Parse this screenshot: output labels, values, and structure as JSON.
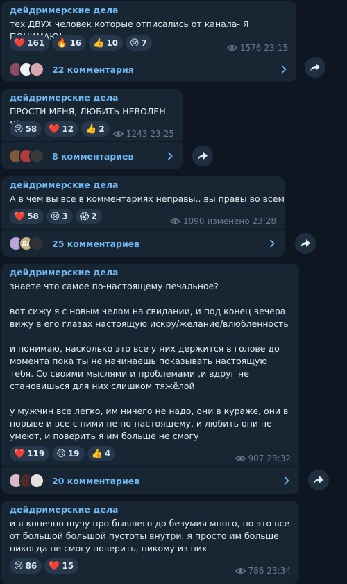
{
  "posts": [
    {
      "channel": "дейдримерские дела",
      "paragraphs": [
        "тех ДВУХ человек которые отписались от канала- Я ПОНИМАЮ!"
      ],
      "reactions": [
        {
          "emoji": "❤️",
          "count": "161"
        },
        {
          "emoji": "🔥",
          "count": "16"
        },
        {
          "emoji": "👍",
          "count": "10"
        },
        {
          "emoji": "😢",
          "count": "7"
        }
      ],
      "views": "1576",
      "time": "23:15",
      "comments": "22 комментария",
      "avatar_colors": [
        "#8a4b63",
        "#f2f2f2",
        "#d8a8b0"
      ]
    },
    {
      "channel": "дейдримерские дела",
      "paragraphs": [
        "ПРОСТИ МЕНЯ, ЛЮБИТЬ НЕВОЛЕН Я("
      ],
      "reactions": [
        {
          "emoji": "😢",
          "count": "58"
        },
        {
          "emoji": "❤️",
          "count": "12"
        },
        {
          "emoji": "👍",
          "count": "2"
        }
      ],
      "views": "1243",
      "time": "23:25",
      "comments": "8 комментариев",
      "avatar_colors": [
        "#7a5a3a",
        "#b03b3b",
        "#3a3a3a"
      ]
    },
    {
      "channel": "дейдримерские дела",
      "paragraphs": [
        "А в чем вы все в комментариях неправы.. вы правы во всем..."
      ],
      "reactions": [
        {
          "emoji": "❤️",
          "count": "58"
        },
        {
          "emoji": "😢",
          "count": "3"
        },
        {
          "emoji": "😱",
          "count": "2"
        }
      ],
      "views": "1090",
      "time": "изменено 23:28",
      "comments": "25 комментариев",
      "avatar_colors": [
        "#b7a7d8",
        "#c7b07a",
        "#2f3338"
      ],
      "avatar_text": [
        "",
        "ДА",
        ""
      ]
    },
    {
      "channel": "дейдримерские дела",
      "paragraphs": [
        "знаете что самое по-настоящему печальное?",
        "вот сижу я с новым челом на свидании, и под конец вечера вижу в его глазах настоящую искру/желание/влюбленность",
        "и понимаю, насколько это все у них держится в голове до момента пока ты не начинаешь показывать настоящую тебя. Со своими мыслями и проблемами ,и вдруг не становишься для них слишком тяжёлой",
        "у мужчин все легко, им ничего не надо, они в кураже, они в порыве и все с ними не по-настоящему, и любить они не умеют, и поверить я им больше не смогу"
      ],
      "reactions": [
        {
          "emoji": "❤️",
          "count": "119"
        },
        {
          "emoji": "😢",
          "count": "19"
        },
        {
          "emoji": "👍",
          "count": "4"
        }
      ],
      "views": "907",
      "time": "23:32",
      "comments": "20 комментариев",
      "avatar_colors": [
        "#d9b8c8",
        "#4a2b2b",
        "#e8e0dc"
      ]
    },
    {
      "channel": "дейдримерские дела",
      "paragraphs": [
        "и я конечно шучу про бывшего до безумия много, но это все от большой большой пустоты внутри. я просто им больше никогда не смогу поверить, никому из них"
      ],
      "reactions": [
        {
          "emoji": "😢",
          "count": "86"
        },
        {
          "emoji": "❤️",
          "count": "15"
        }
      ],
      "views": "786",
      "time": "23:34"
    }
  ],
  "colors": {
    "background": "#0e1621",
    "bubble": "#182533",
    "accent": "#71baf5",
    "reaction_bg": "#26384c",
    "meta": "#6d7f8f"
  },
  "icons": {
    "views": "eye-icon",
    "comments_arrow": "chevron-right-icon",
    "share": "share-icon"
  }
}
